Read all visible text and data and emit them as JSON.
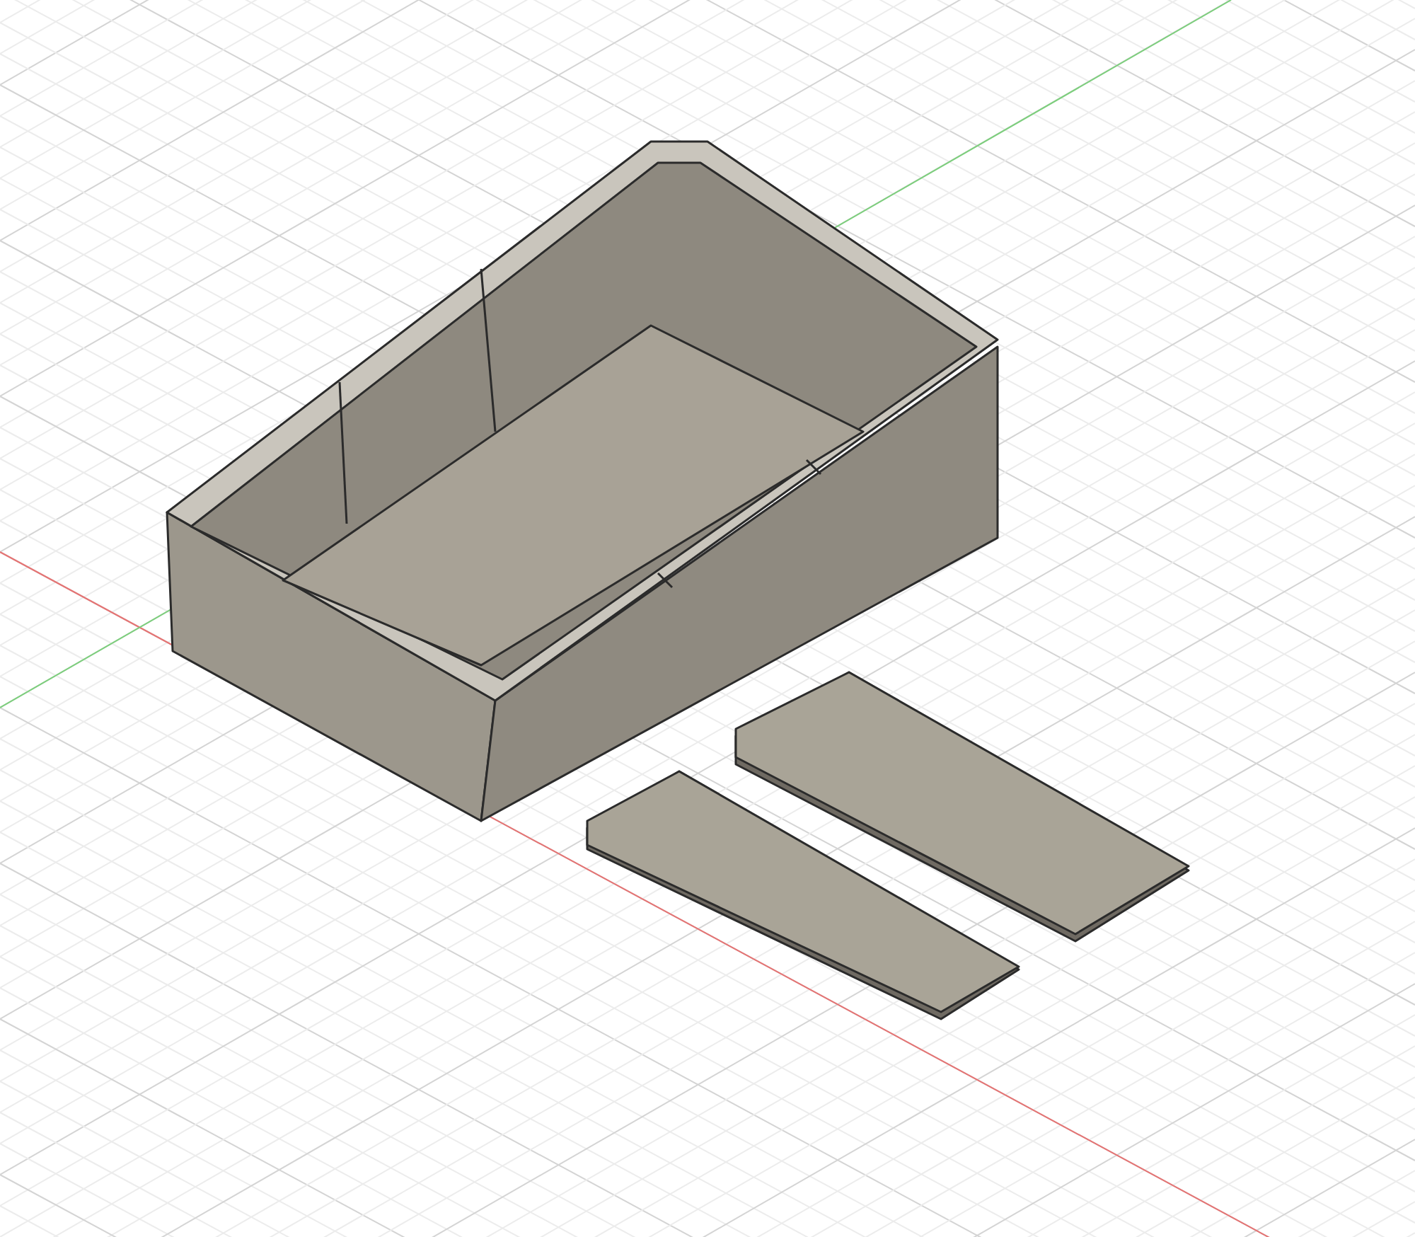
{
  "viewport": {
    "axes": [
      {
        "kind": "x",
        "color": "#e57373"
      },
      {
        "kind": "y",
        "color": "#7ccf7c"
      }
    ]
  }
}
